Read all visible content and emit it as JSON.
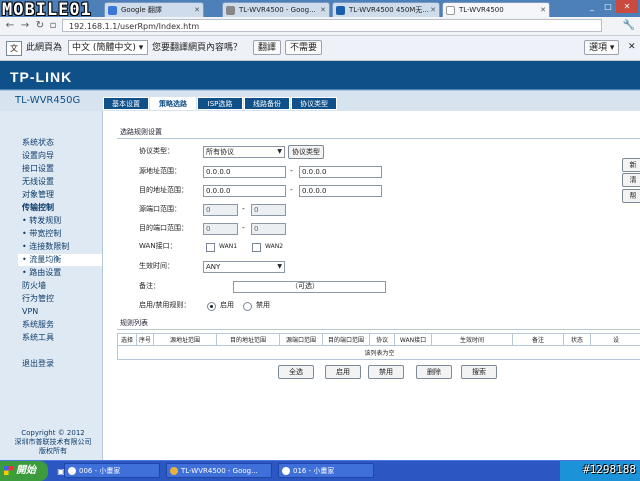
{
  "browser": {
    "tabs": [
      {
        "label": "Google 翻譯",
        "fav_color": "#3b77d8"
      },
      {
        "label": "TL-WVR4500 - Goog...",
        "fav_color": "#888888"
      },
      {
        "label": "TL-WVR4500 450M无...",
        "fav_color": "#1b5fb0"
      },
      {
        "label": "TL-WVR4500",
        "fav_color": "#ffffff"
      }
    ],
    "url": "192.168.1.1/userRpm/Index.htm",
    "logo_overlay": "MOBILE01",
    "translate": {
      "prefix": "此網頁為",
      "language": "中文 (簡體中文)",
      "question": "您要翻譯網頁內容嗎？",
      "translate_btn": "翻譯",
      "no_btn": "不需要",
      "options": "選項"
    }
  },
  "router": {
    "brand": "TP-LINK",
    "model": "TL-WVR450G",
    "tabs": [
      "基本设置",
      "策略选路",
      "ISP选路",
      "线路备份",
      "协议类型"
    ],
    "sidebar": [
      {
        "label": "系统状态"
      },
      {
        "label": "设置向导"
      },
      {
        "label": "接口设置"
      },
      {
        "label": "无线设置"
      },
      {
        "label": "对象管理"
      },
      {
        "label": "传输控制",
        "bold": true
      },
      {
        "label": "• 转发规则"
      },
      {
        "label": "• 带宽控制"
      },
      {
        "label": "• 连接数限制"
      },
      {
        "label": "• 流量均衡",
        "active": true
      },
      {
        "label": "• 路由设置"
      },
      {
        "label": "防火墙"
      },
      {
        "label": "行为管控"
      },
      {
        "label": "VPN"
      },
      {
        "label": "系统服务"
      },
      {
        "label": "系统工具"
      },
      {
        "label": ""
      },
      {
        "label": "退出登录"
      }
    ],
    "copyright": [
      "Copyright © 2012",
      "深圳市普联技术有限公司",
      "版权所有"
    ],
    "form": {
      "section_title": "选路规则设置",
      "protocol_label": "协议类型：",
      "protocol_value": "所有协议",
      "protocol_btn": "协议类型",
      "src_addr_label": "源地址范围：",
      "src_addr_from": "0.0.0.0",
      "src_addr_to": "0.0.0.0",
      "dst_addr_label": "目的地址范围：",
      "dst_addr_from": "0.0.0.0",
      "dst_addr_to": "0.0.0.0",
      "src_port_label": "源端口范围：",
      "src_port_from": "0",
      "src_port_to": "0",
      "dst_port_label": "目的端口范围：",
      "dst_port_from": "0",
      "dst_port_to": "0",
      "wan_label": "WAN接口：",
      "wan1": "WAN1",
      "wan2": "WAN2",
      "time_label": "生效时间：",
      "time_value": "ANY",
      "note_label": "备注：",
      "note_value": "",
      "note_hint": "（可选）",
      "enable_label": "启用/禁用规则：",
      "enable_on": "启用",
      "enable_off": "禁用",
      "side_buttons": [
        "新",
        "清",
        "帮"
      ]
    },
    "list": {
      "section_title": "规则列表",
      "columns": [
        "选择",
        "序号",
        "源地址范围",
        "目的地址范围",
        "源端口范围",
        "目的端口范围",
        "协议",
        "WAN接口",
        "生效时间",
        "备注",
        "状态",
        "设"
      ],
      "empty_text": "该列表为空",
      "buttons": [
        "全选",
        "启用",
        "禁用",
        "删除",
        "搜索"
      ]
    }
  },
  "taskbar": {
    "start": "開始",
    "tasks": [
      "006 - 小畫家",
      "TL-WVR4500 - Goog...",
      "016 - 小畫家"
    ],
    "watermark": "#1298188"
  }
}
